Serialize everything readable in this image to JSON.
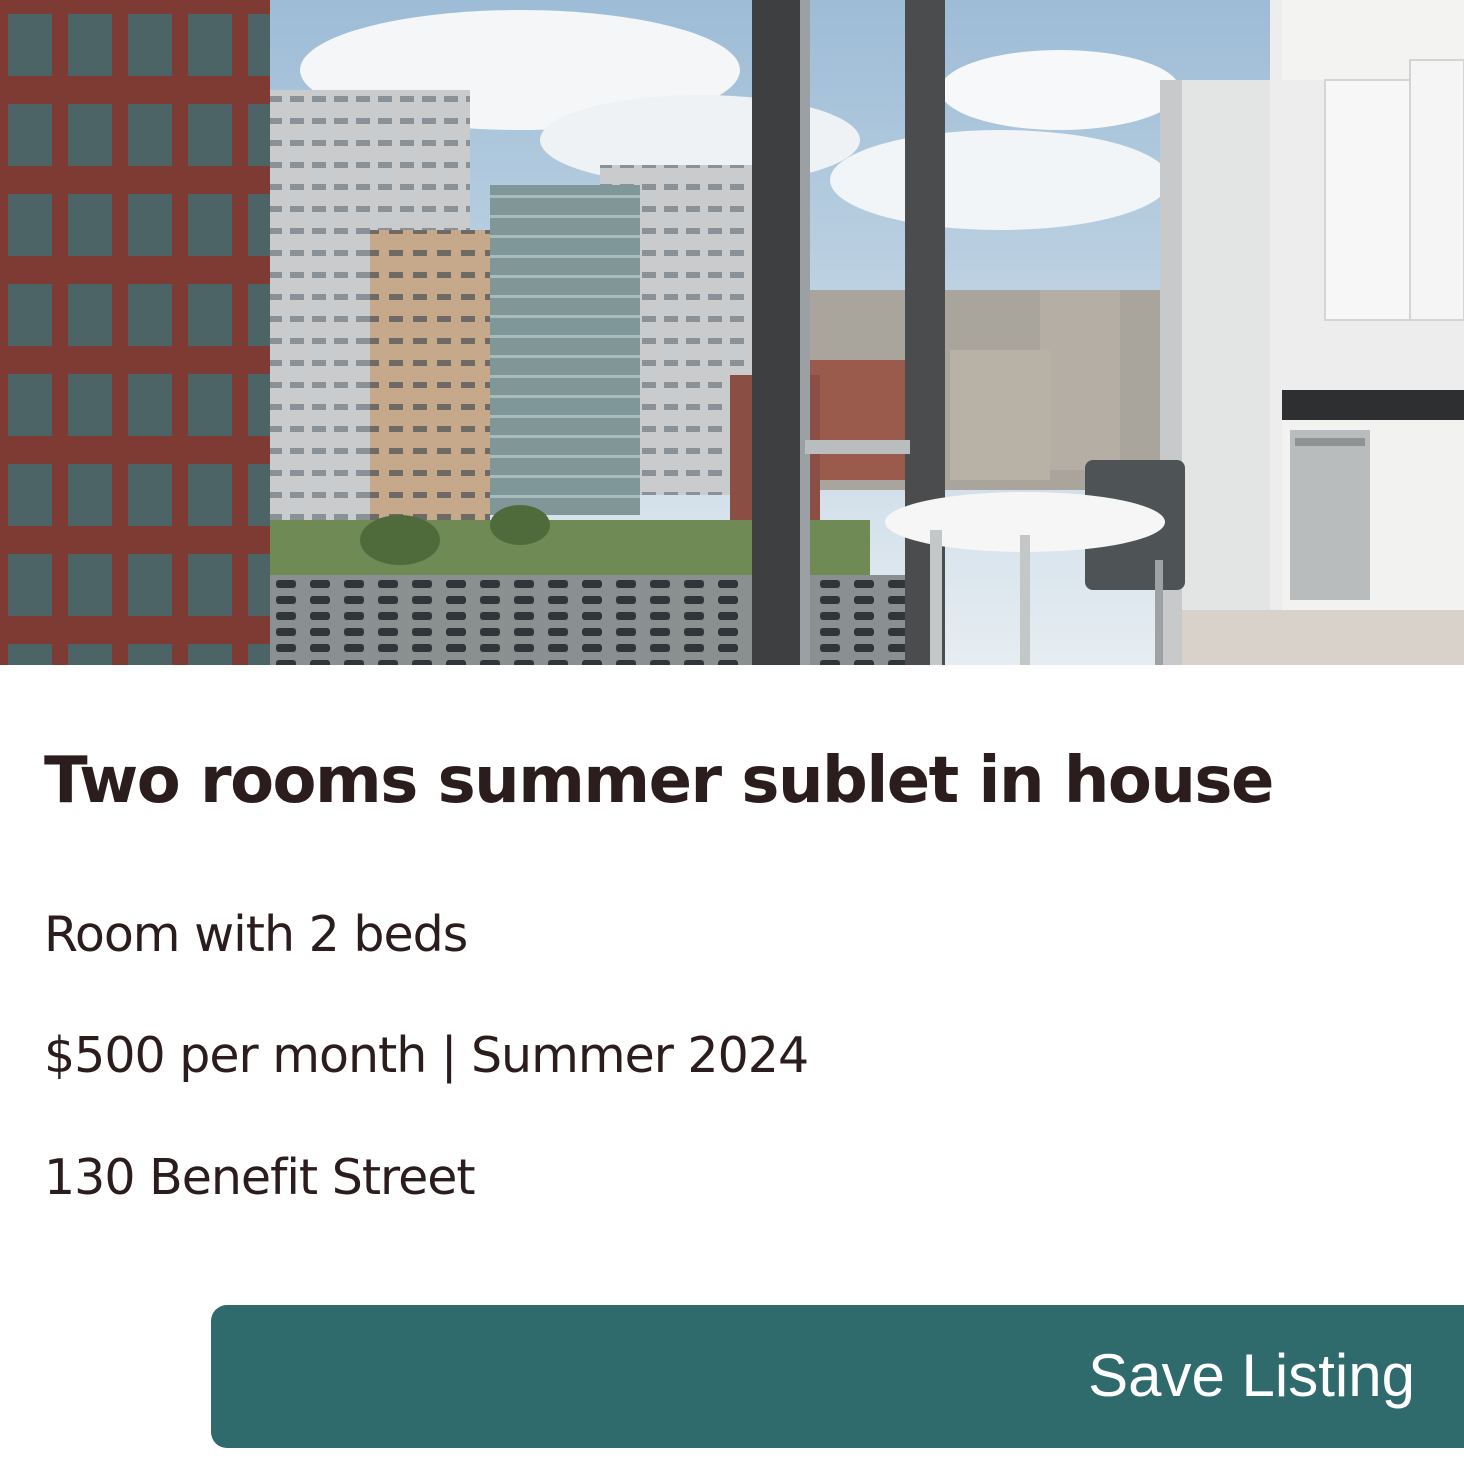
{
  "listing": {
    "title": "Two rooms summer sublet in house",
    "room_info": "Room with 2 beds",
    "price_term": "$500 per month | Summer 2024",
    "address": "130 Benefit Street"
  },
  "actions": {
    "save_label": "Save Listing"
  },
  "colors": {
    "button": "#2f6b6d",
    "text": "#2b1d1d",
    "background": "#ffffff"
  }
}
